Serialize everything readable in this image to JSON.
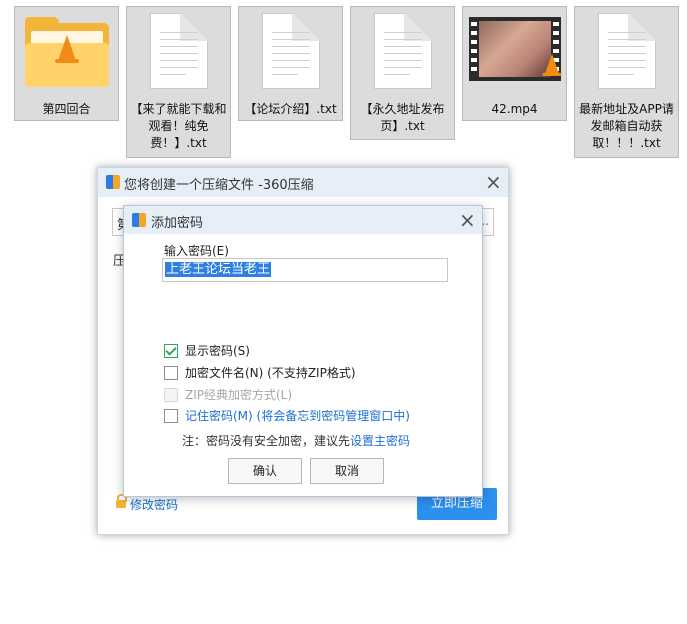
{
  "desktop": {
    "files": [
      {
        "name": "第四回合",
        "type": "folder",
        "icon": "folder-vlc-icon"
      },
      {
        "name": "【来了就能下载和观看！纯免费！】.txt",
        "type": "text",
        "icon": "text-file-icon"
      },
      {
        "name": "【论坛介绍】.txt",
        "type": "text",
        "icon": "text-file-icon"
      },
      {
        "name": "【永久地址发布页】.txt",
        "type": "text",
        "icon": "text-file-icon"
      },
      {
        "name": "42.mp4",
        "type": "video",
        "icon": "video-file-icon"
      },
      {
        "name": "最新地址及APP请发邮箱自动获取！！！.txt",
        "type": "text",
        "icon": "text-file-icon"
      }
    ]
  },
  "compress_dialog": {
    "title": "您将创建一个压缩文件 -360压缩",
    "side_label": "压",
    "path_prefix": "第",
    "path_suffix": "...",
    "change_password_link": "修改密码",
    "compress_button": "立即压缩"
  },
  "password_dialog": {
    "title": "添加密码",
    "password_label": "输入密码(E)",
    "password_value": "上老王论坛当老王",
    "options": [
      {
        "label": "显示密码(S)",
        "checked": true,
        "disabled": false
      },
      {
        "label": "加密文件名(N) (不支持ZIP格式)",
        "checked": false,
        "disabled": false
      },
      {
        "label": "ZIP经典加密方式(L)",
        "checked": false,
        "disabled": true
      },
      {
        "label": "记住密码(M) (将会备忘到密码管理窗口中)",
        "checked": false,
        "disabled": false
      }
    ],
    "note_text": "注：密码没有安全加密，建议先",
    "note_link": "设置主密码",
    "ok_button": "确认",
    "cancel_button": "取消"
  },
  "colors": {
    "accent": "#2d8ff0",
    "link": "#1a6fd6",
    "titlebar": "#e6eef8",
    "folder": "#f2b43a"
  }
}
